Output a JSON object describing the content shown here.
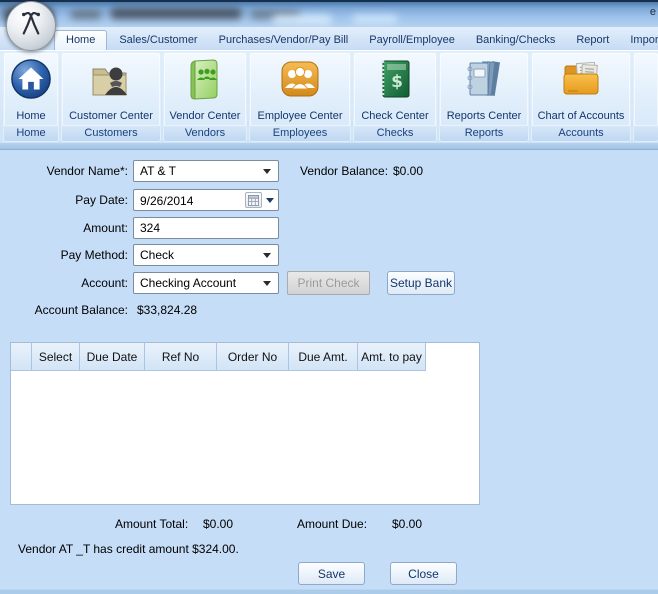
{
  "titlebar": {
    "partial_text": "e"
  },
  "tabs": [
    {
      "label": "Home",
      "selected": true
    },
    {
      "label": "Sales/Customer",
      "selected": false
    },
    {
      "label": "Purchases/Vendor/Pay Bill",
      "selected": false
    },
    {
      "label": "Payroll/Employee",
      "selected": false
    },
    {
      "label": "Banking/Checks",
      "selected": false
    },
    {
      "label": "Report",
      "selected": false
    },
    {
      "label": "Import/Expo",
      "selected": false
    }
  ],
  "ribbon": {
    "groups": [
      {
        "button": "Home",
        "group": "Home",
        "icon": "home-icon"
      },
      {
        "button": "Customer Center",
        "group": "Customers",
        "icon": "customer-center-icon"
      },
      {
        "button": "Vendor Center",
        "group": "Vendors",
        "icon": "vendor-center-icon"
      },
      {
        "button": "Employee Center",
        "group": "Employees",
        "icon": "employee-center-icon"
      },
      {
        "button": "Check Center",
        "group": "Checks",
        "icon": "check-center-icon"
      },
      {
        "button": "Reports Center",
        "group": "Reports",
        "icon": "reports-center-icon"
      },
      {
        "button": "Chart of Accounts",
        "group": "Accounts",
        "icon": "chart-of-accounts-icon"
      }
    ]
  },
  "form": {
    "vendor_name_label": "Vendor Name*:",
    "vendor_name_value": "AT & T",
    "vendor_balance_label": "Vendor Balance:",
    "vendor_balance_value": "$0.00",
    "pay_date_label": "Pay Date:",
    "pay_date_value": "9/26/2014",
    "amount_label": "Amount:",
    "amount_value": "324",
    "pay_method_label": "Pay Method:",
    "pay_method_value": "Check",
    "account_label": "Account:",
    "account_value": "Checking Account",
    "print_check_label": "Print Check",
    "setup_bank_label": "Setup Bank",
    "account_balance_label": "Account Balance:",
    "account_balance_value": "$33,824.28"
  },
  "table": {
    "columns": [
      "Select",
      "Due Date",
      "Ref No",
      "Order No",
      "Due Amt.",
      "Amt. to pay"
    ],
    "rows": []
  },
  "totals": {
    "amount_total_label": "Amount Total:",
    "amount_total_value": "$0.00",
    "amount_due_label": "Amount Due:",
    "amount_due_value": "$0.00"
  },
  "credit_note": "Vendor AT _T has credit amount $324.00.",
  "actions": {
    "save": "Save",
    "close": "Close"
  },
  "colors": {
    "form_background": "#c6ddf7",
    "tab_text": "#17386b",
    "header_cell": "#d2e4f6",
    "disabled_button_text": "#9b9b9b"
  }
}
